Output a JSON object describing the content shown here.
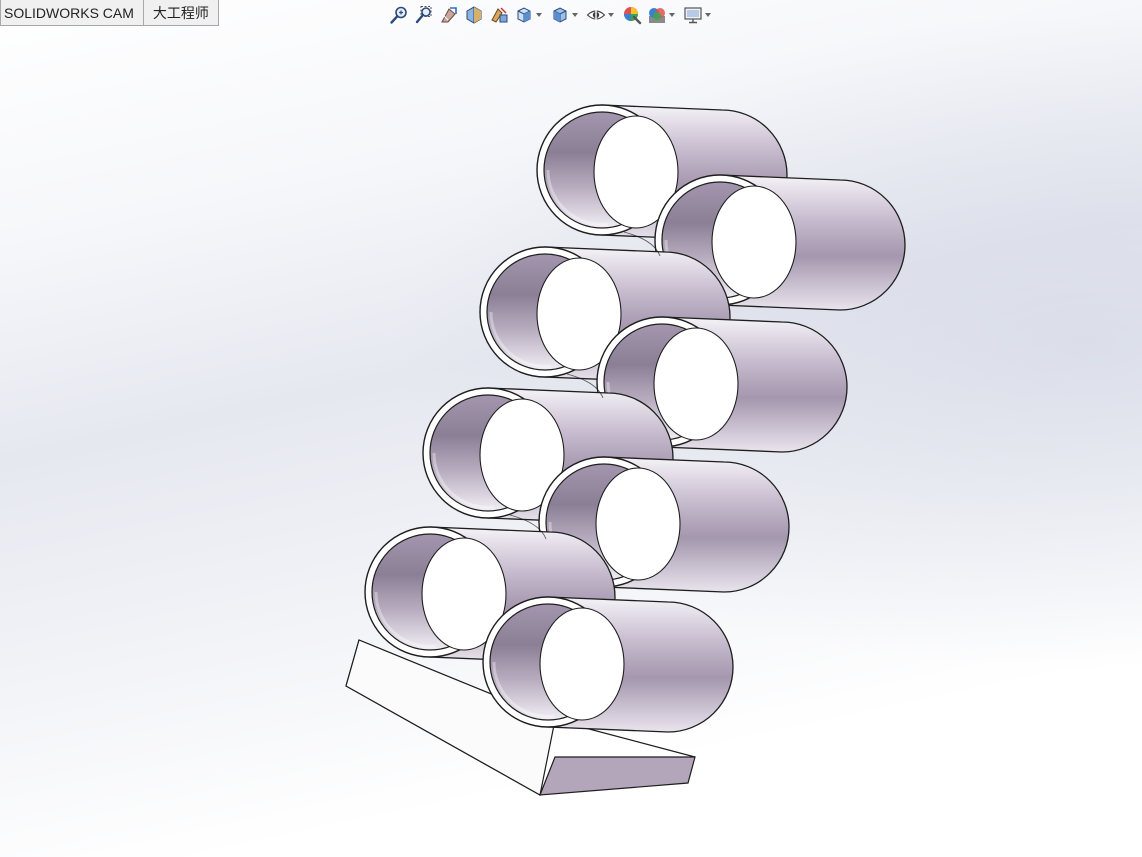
{
  "tabs": [
    {
      "label": "SOLIDWORKS CAM"
    },
    {
      "label": "大工程师"
    }
  ],
  "toolbar": {
    "icons": [
      "zoom-to-fit-icon",
      "zoom-to-area-icon",
      "previous-view-icon",
      "section-view-icon",
      "view-selector-icon",
      "view-orientation-icon",
      "display-style-icon",
      "hide-show-items-icon",
      "edit-appearance-icon",
      "apply-scene-icon",
      "view-settings-icon"
    ]
  },
  "colors": {
    "tube_light": "#f4f2f6",
    "tube_mid": "#b3a6be",
    "tube_dark": "#8e8298",
    "edge": "#1e1e1e",
    "base_top": "#ffffff",
    "base_front": "#b3a6bb"
  }
}
